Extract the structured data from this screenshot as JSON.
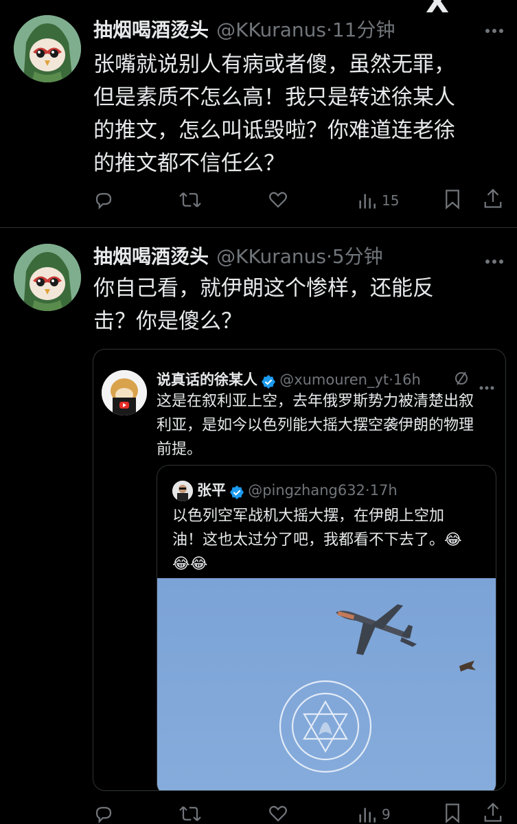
{
  "top_right_fragment": "X",
  "tweets": [
    {
      "name": "抽烟喝酒烫头",
      "handle": "@KKuranus",
      "time": "11分钟",
      "lines": [
        "张嘴就说别人有病或者傻，虽然无罪，",
        "但是素质不怎么高！我只是转述徐某人",
        "的推文，怎么叫诋毁啦？你难道连老徐",
        "的推文都不信任么？"
      ],
      "views": "15"
    },
    {
      "name": "抽烟喝酒烫头",
      "handle": "@KKuranus",
      "time": "5分钟",
      "lines": [
        "你自己看，就伊朗这个惨样，还能反",
        "击？你是傻么？"
      ],
      "views": "9"
    }
  ],
  "quote": {
    "name": "说真话的徐某人",
    "handle": "@xumouren_yt",
    "time": "16h",
    "lines": [
      "这是在叙利亚上空，去年俄罗斯势力被清楚出叙",
      "利亚，是如今以色列能大摇大摆空袭伊朗的物理",
      "前提。"
    ],
    "nested": {
      "name": "张平",
      "handle": "@pingzhang632",
      "time": "17h",
      "lines": [
        "以色列空军战机大摇大摆，在伊朗上空加",
        "油！这也太过分了吧，我都看不下去了。"
      ],
      "emoji": [
        "😂",
        "😂",
        "😂"
      ]
    }
  },
  "colors": {
    "background": "#000000",
    "text": "#e7e9ea",
    "secondary": "#71767b",
    "verified": "#1d9bf0",
    "sky": "#7fa6d8"
  },
  "icons": [
    "reply-icon",
    "retweet-icon",
    "like-icon",
    "views-icon",
    "bookmark-icon",
    "share-icon",
    "more-icon",
    "verified-badge-icon",
    "hide-icon"
  ]
}
